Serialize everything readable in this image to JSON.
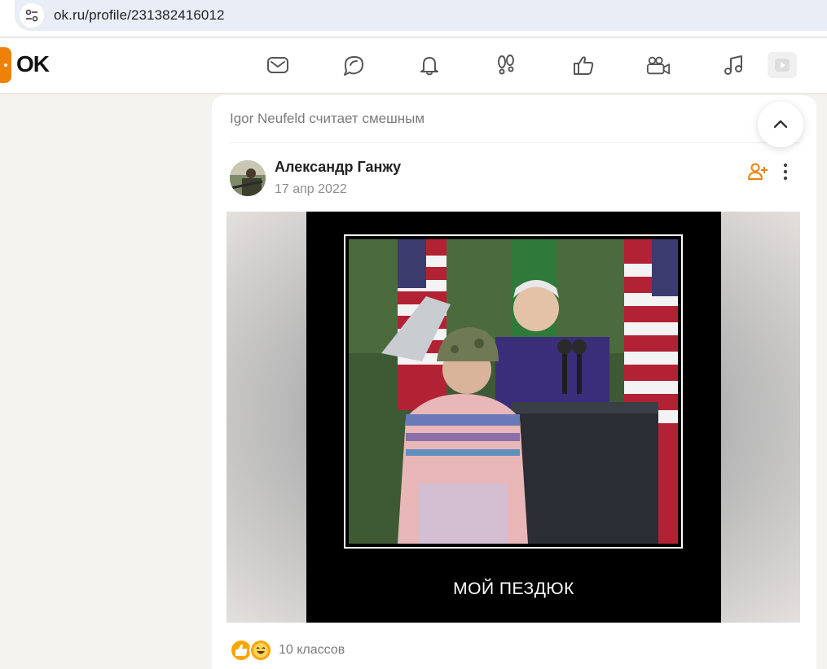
{
  "browser": {
    "url": "ok.ru/profile/231382416012",
    "site_info_icon": "tune-icon"
  },
  "header": {
    "logo_text": "OK",
    "brand_color": "#ee8208",
    "nav_icons": [
      "messages-icon",
      "discussions-icon",
      "notifications-icon",
      "guests-icon",
      "marks-icon",
      "video-call-icon",
      "music-icon",
      "video-icon"
    ]
  },
  "post": {
    "reshare_text": "Igor Neufeld считает смешным",
    "author": "Александр Ганжу",
    "date": "17 апр 2022",
    "image_caption": "МОЙ ПЕЗДЮК",
    "reactions_text": "10 классов",
    "reaction_icons": [
      "like-icon",
      "laugh-icon"
    ]
  }
}
